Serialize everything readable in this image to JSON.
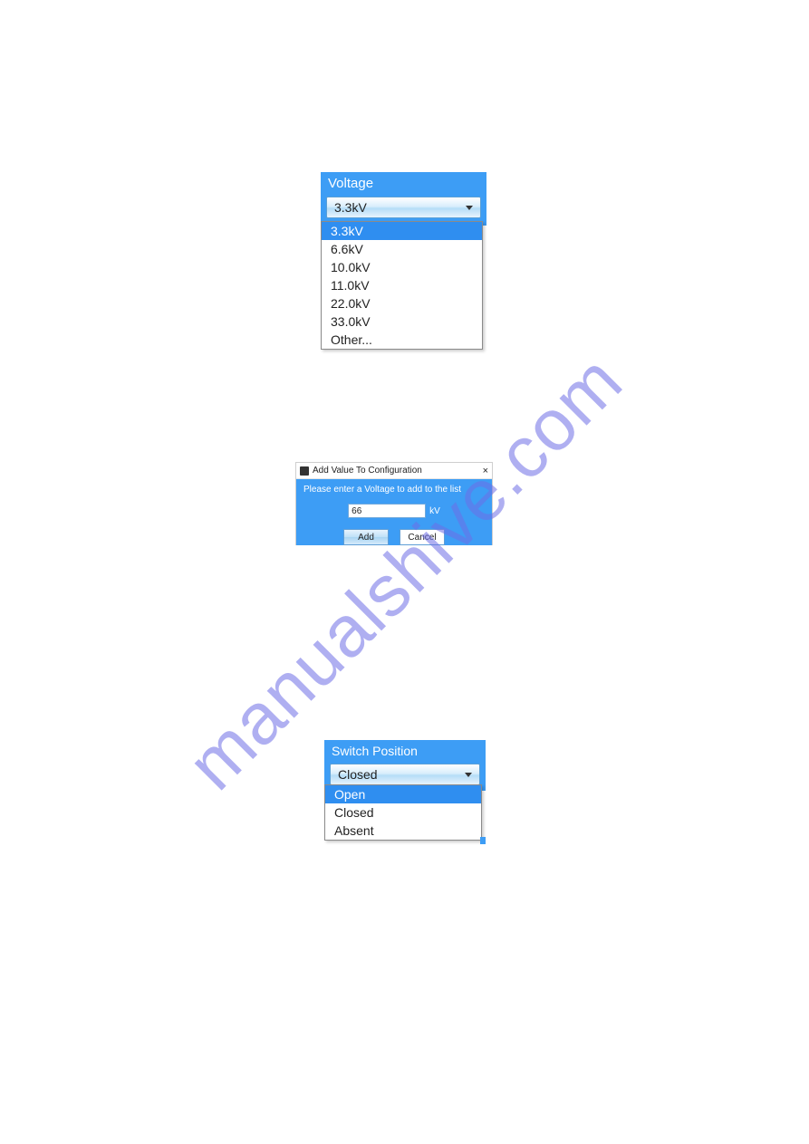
{
  "watermark": "manualshive.com",
  "voltage": {
    "header": "Voltage",
    "selected": "3.3kV",
    "options": [
      "3.3kV",
      "6.6kV",
      "10.0kV",
      "11.0kV",
      "22.0kV",
      "33.0kV",
      "Other..."
    ]
  },
  "dialog": {
    "title": "Add Value To Configuration",
    "close": "×",
    "prompt": "Please enter a Voltage to add to the list",
    "input_value": "66",
    "unit": "kV",
    "add_label": "Add",
    "cancel_label": "Cancel"
  },
  "switch": {
    "header": "Switch Position",
    "selected": "Closed",
    "options": [
      "Open",
      "Closed",
      "Absent"
    ]
  }
}
